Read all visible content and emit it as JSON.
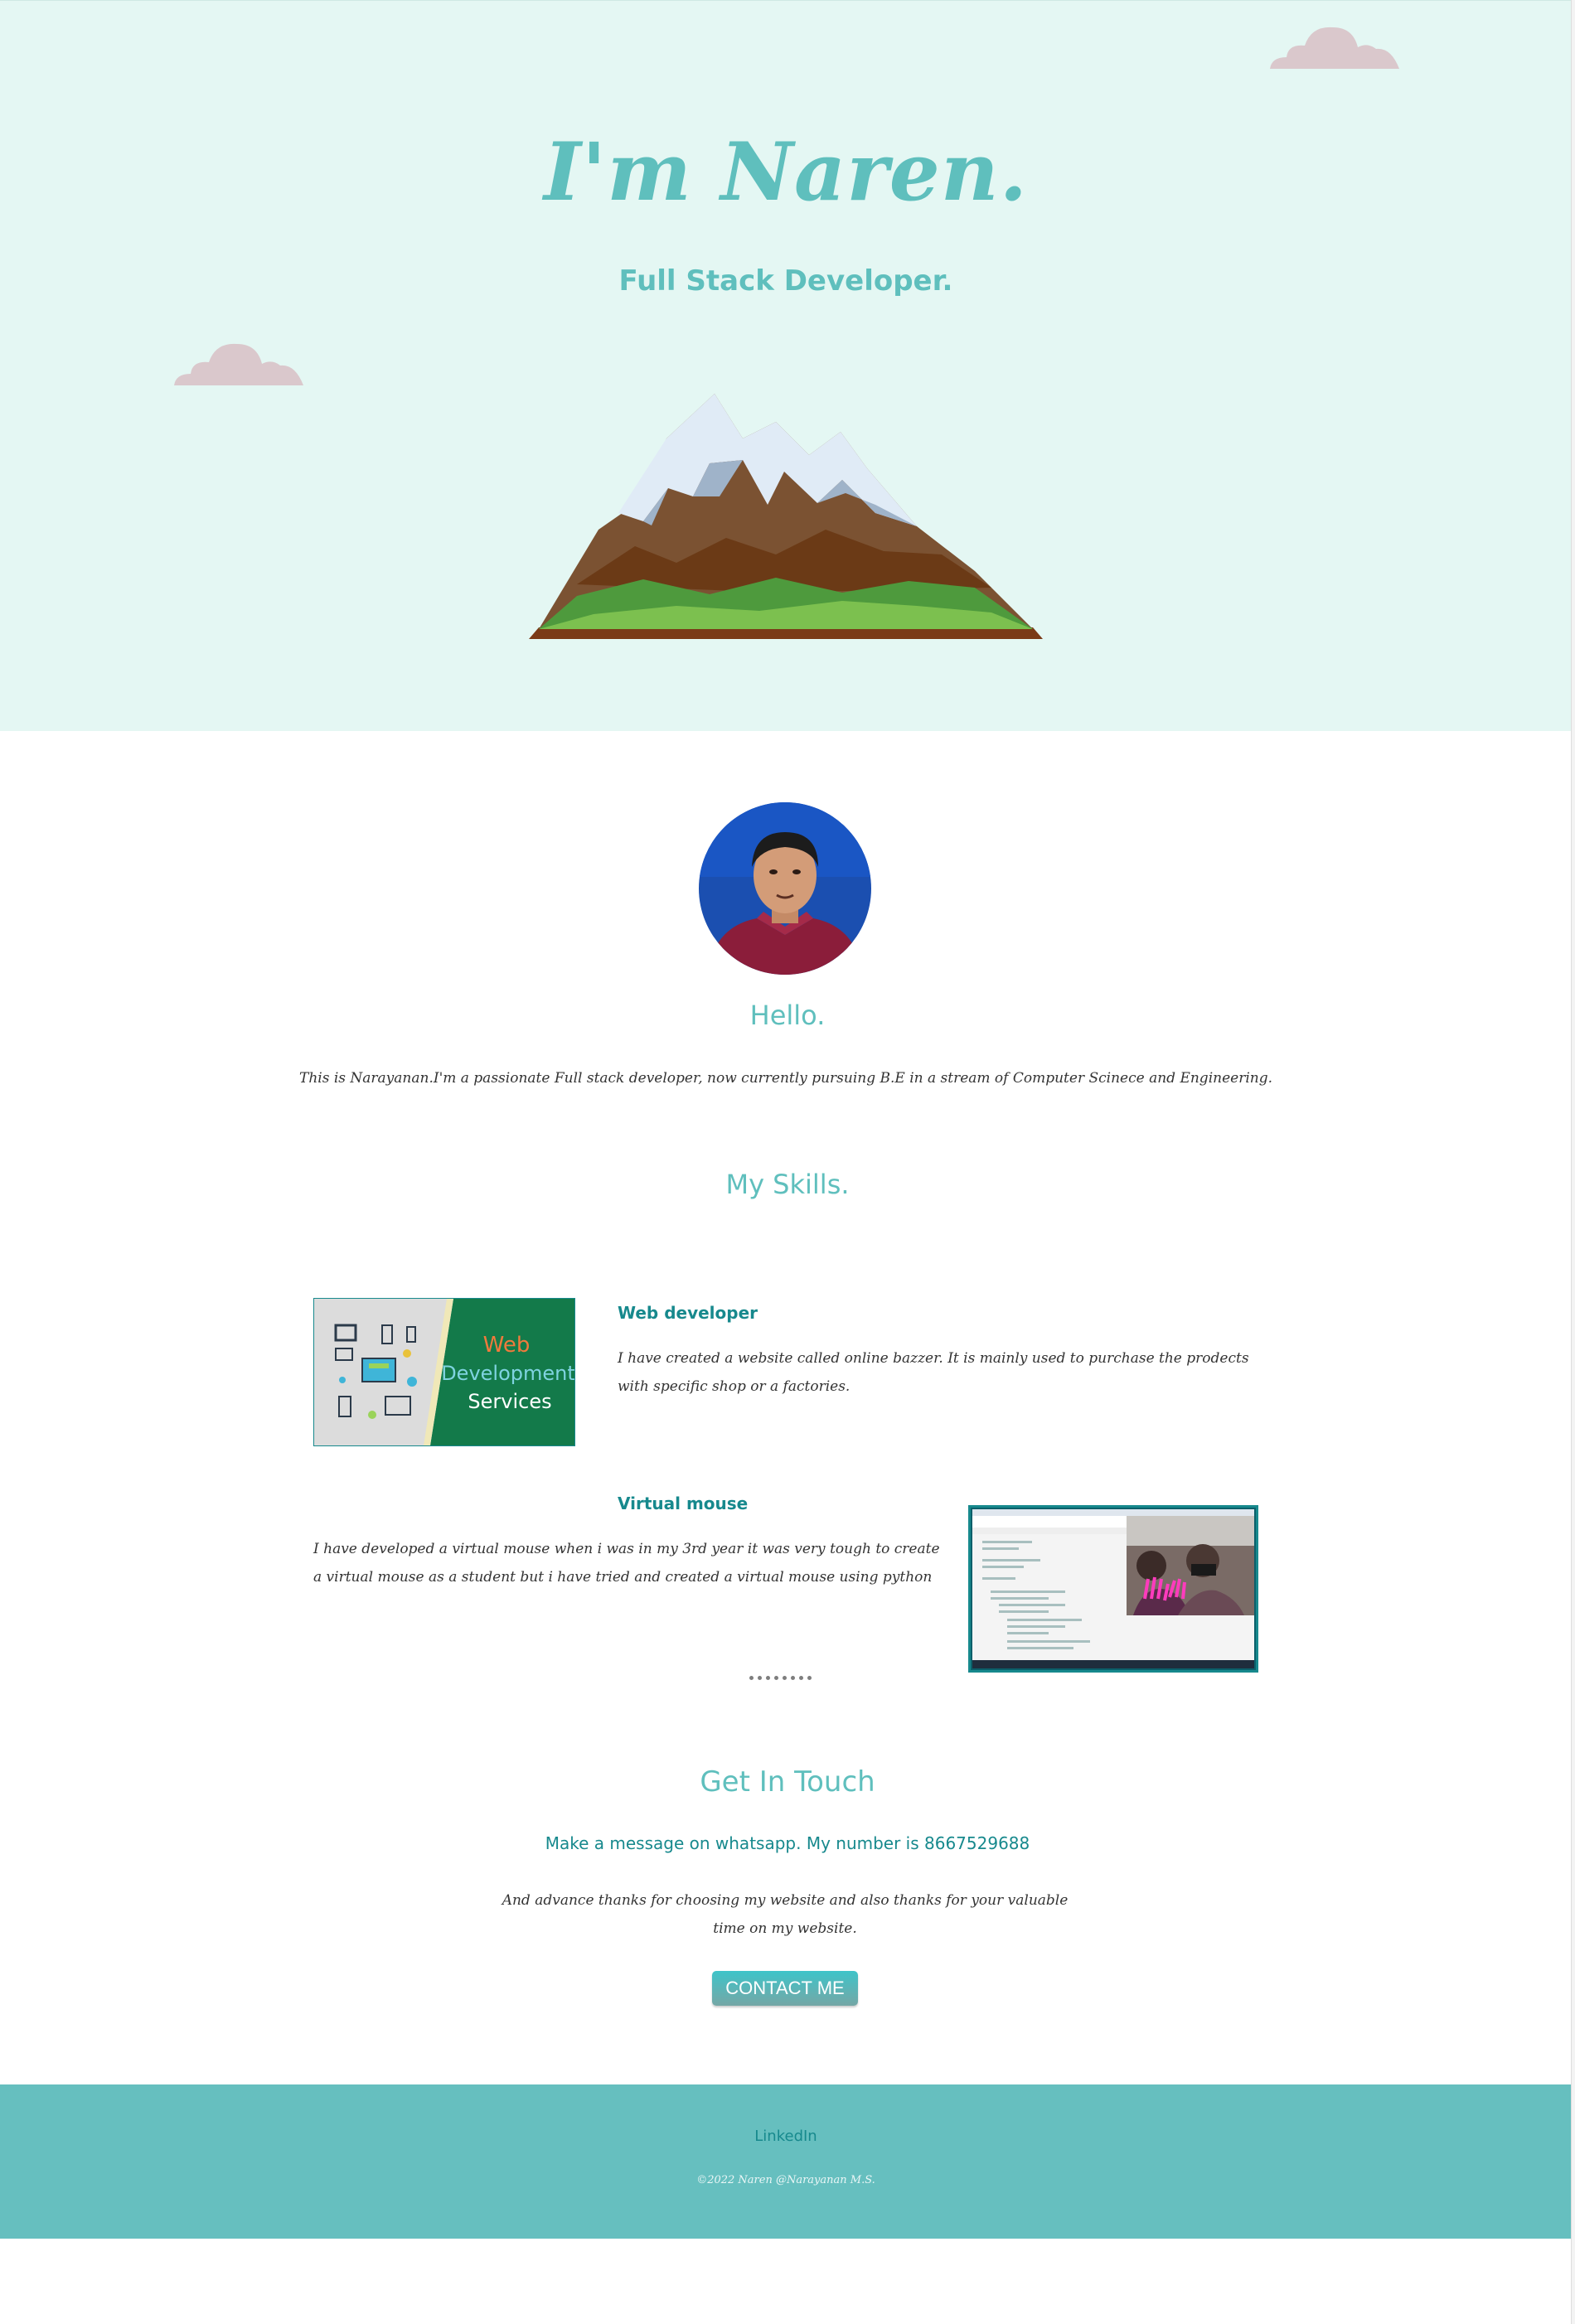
{
  "hero": {
    "title": "I'm Naren.",
    "subtitle": "Full Stack Developer."
  },
  "about": {
    "heading": "Hello.",
    "text": "This is Narayanan.I'm a passionate Full stack developer, now currently pursuing B.E in a stream of Computer Scinece and Engineering."
  },
  "skills": {
    "heading": "My Skills.",
    "items": [
      {
        "title": "Web developer",
        "text": "I have created a website called online bazzer. It is mainly used to purchase the prodects with specific shop or a factories.",
        "image_text": [
          "Web",
          "Development",
          "Services"
        ]
      },
      {
        "title": "Virtual mouse",
        "text": "I have developed a virtual mouse when i was in my 3rd year it was very tough to create a virtual mouse as a student but i have tried and created a virtual mouse using python"
      }
    ]
  },
  "contact": {
    "heading": "Get In Touch",
    "subheading": "Make a message on whatsapp. My number is 8667529688",
    "text": "And advance thanks for choosing my website and also thanks for your valuable time on my website.",
    "button_label": "CONTACT ME"
  },
  "footer": {
    "link_label": "LinkedIn",
    "copyright": "©2022 Naren @Narayanan M.S."
  },
  "colors": {
    "top_bg": "#e4f7f3",
    "accent": "#5fbfbd",
    "dark_teal": "#17898d",
    "footer_bg": "#66bfbf",
    "cloud": "#dac8cc"
  },
  "icons": [
    "cloud-icon",
    "mountain-illustration",
    "profile-photo"
  ]
}
